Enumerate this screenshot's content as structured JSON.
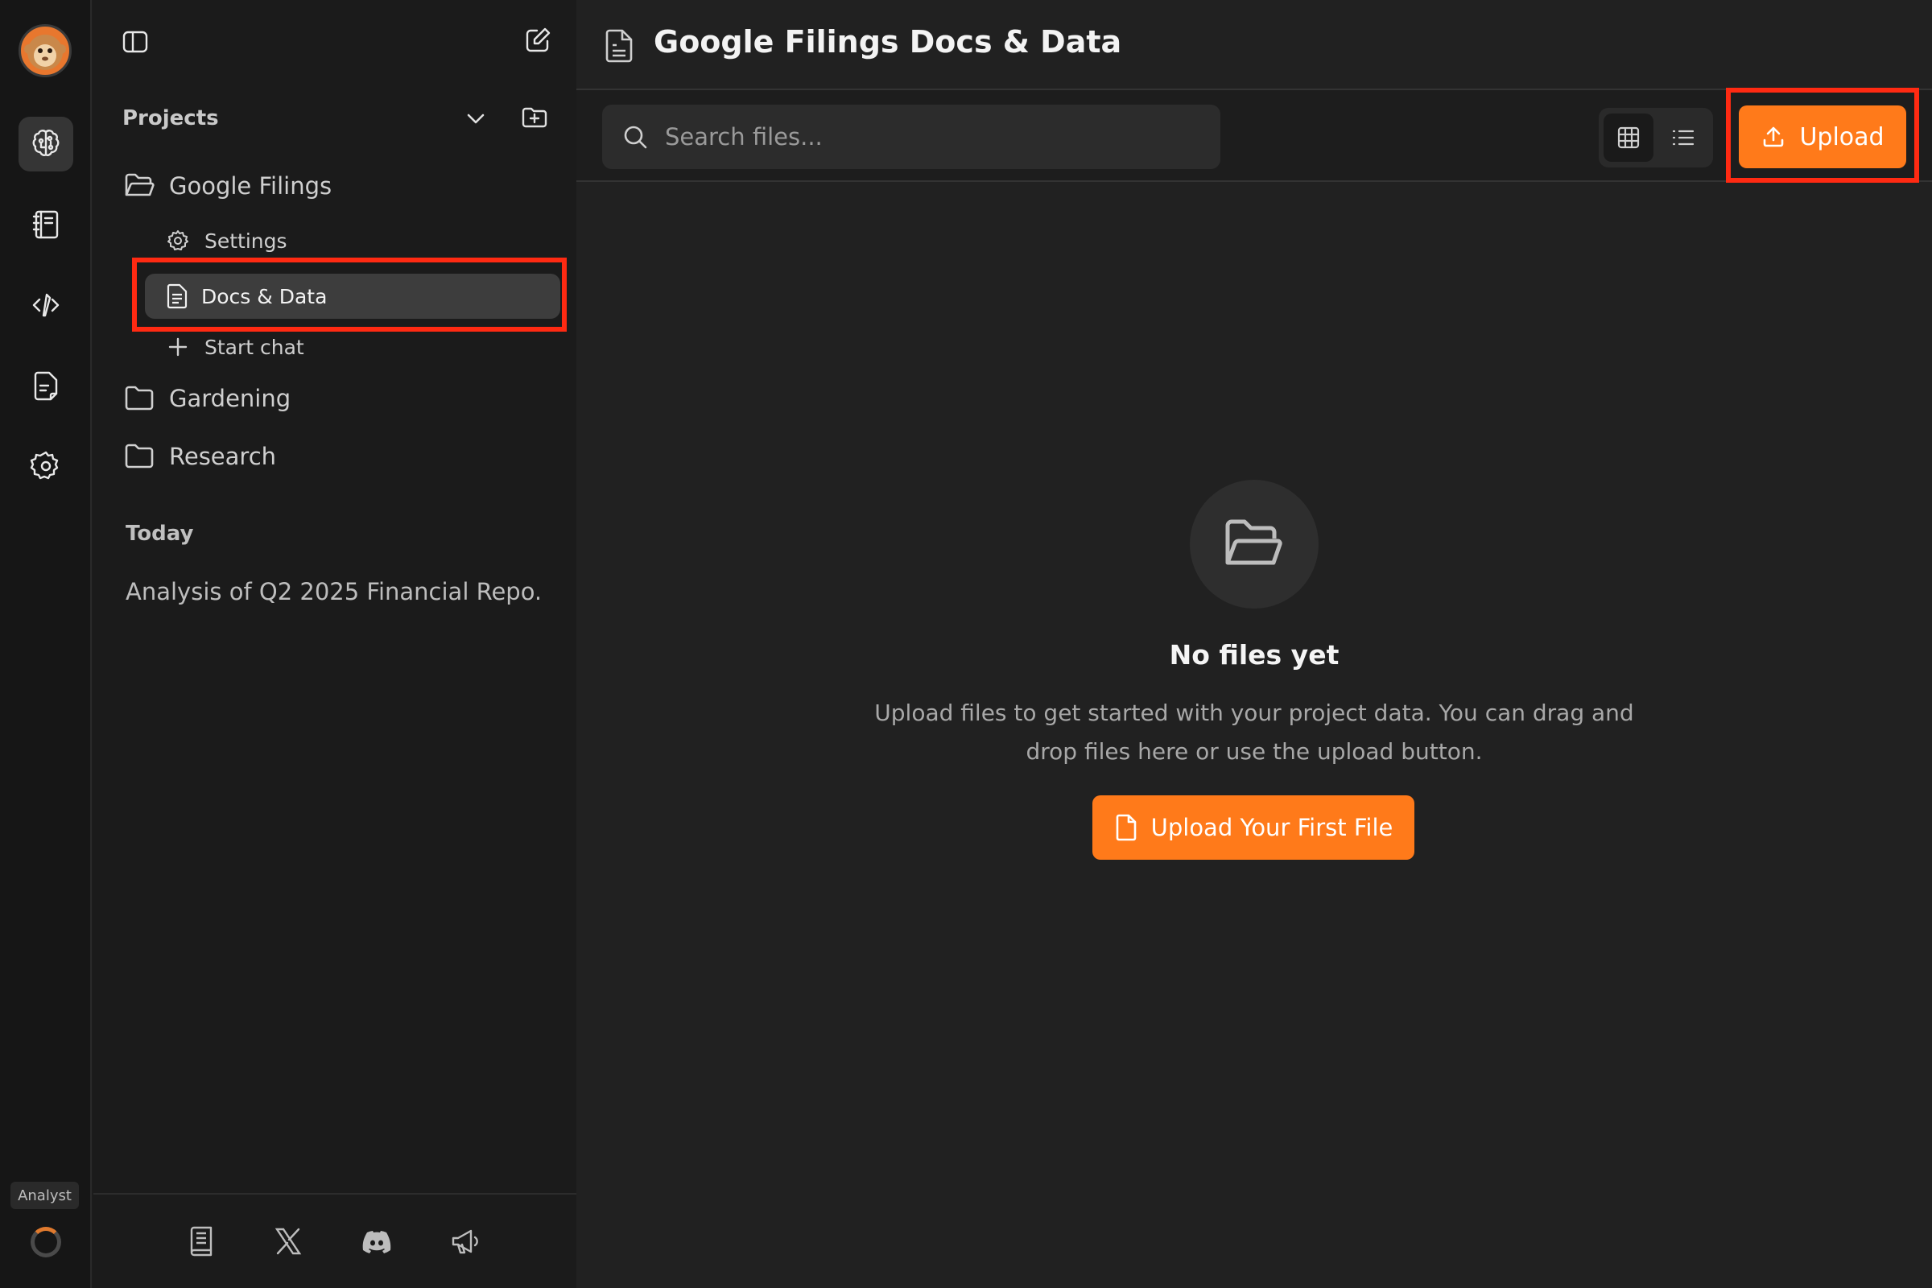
{
  "rail": {
    "avatar_icon": "monkey-avatar-icon",
    "items": [
      {
        "icon": "brain-icon",
        "active": true
      },
      {
        "icon": "notebook-icon",
        "active": false
      },
      {
        "icon": "code-pen-icon",
        "active": false
      },
      {
        "icon": "document-icon",
        "active": false
      },
      {
        "icon": "gear-icon",
        "active": false
      }
    ],
    "badge": "Analyst"
  },
  "sidebar": {
    "toggle_icon": "sidebar-toggle-icon",
    "new_chat_icon": "edit-icon",
    "projects_label": "Projects",
    "projects": [
      {
        "name": "Google Filings",
        "open": true,
        "children": [
          {
            "label": "Settings",
            "icon": "gear-icon"
          },
          {
            "label": "Docs & Data",
            "icon": "document-icon",
            "selected": true
          },
          {
            "label": "Start chat",
            "icon": "plus-icon"
          }
        ]
      },
      {
        "name": "Gardening",
        "open": false
      },
      {
        "name": "Research",
        "open": false
      }
    ],
    "today_label": "Today",
    "chats": [
      "Analysis of Q2 2025 Financial Repo..."
    ],
    "footer_icons": [
      "book-icon",
      "x-logo-icon",
      "discord-icon",
      "megaphone-icon"
    ]
  },
  "main": {
    "title": "Google Filings Docs & Data",
    "search_placeholder": "Search files...",
    "upload_label": "Upload",
    "empty": {
      "title": "No files yet",
      "description": "Upload files to get started with your project data. You can drag and drop files here or use the upload button.",
      "button_label": "Upload Your First File"
    }
  },
  "colors": {
    "accent": "#ff7a1a",
    "highlight": "#ff2a12",
    "background": "#212121",
    "sidebar": "#1b1b1b"
  }
}
